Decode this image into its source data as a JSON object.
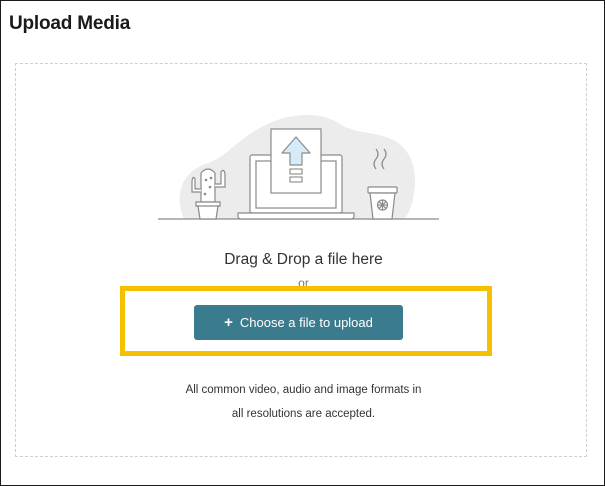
{
  "header": {
    "title": "Upload Media"
  },
  "dropzone": {
    "illustration_icon": "laptop-upload-illustration",
    "drag_text": "Drag & Drop a file here",
    "or_text": "or",
    "button_label": "Choose a file to upload",
    "button_icon": "plus-icon",
    "formats_line1": "All common video, audio and image formats in",
    "formats_line2": "all resolutions are accepted."
  },
  "colors": {
    "button_bg": "#3b7b8e",
    "highlight": "#f5c000",
    "dashed_border": "#cfcfcf",
    "illustration_fill": "#ececec",
    "illustration_stroke": "#8a8a8a",
    "arrow_fill": "#d6ebf7"
  }
}
